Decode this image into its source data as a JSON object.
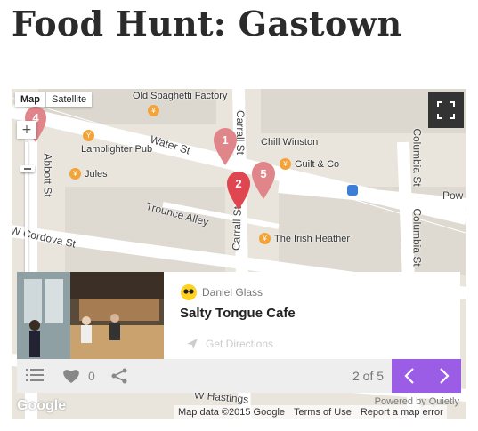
{
  "page": {
    "title": "Food Hunt: Gastown"
  },
  "map": {
    "type_options": [
      "Map",
      "Satellite"
    ],
    "streets": {
      "water_st": "Water St",
      "carrall_st_top": "Carrall St",
      "carrall_st_bottom": "Carrall St",
      "abbott_st": "Abbott St",
      "trounce_alley": "Trounce Alley",
      "w_cordova_st": "W Cordova St",
      "columbia_st_top": "Columbia St",
      "columbia_st_mid": "Columbia St",
      "powell": "Pow",
      "w_hastings": "W Hastings"
    },
    "places": {
      "old_spaghetti": "Old Spaghetti Factory",
      "lamplighter": "Lamplighter Pub",
      "jules": "Jules",
      "chill_winston": "Chill Winston",
      "guilt_co": "Guilt & Co",
      "irish_heather": "The Irish Heather"
    },
    "markers": [
      "1",
      "2",
      "4",
      "5"
    ],
    "attribution": {
      "data": "Map data ©2015 Google",
      "terms": "Terms of Use",
      "report": "Report a map error",
      "google_logo": "Google"
    }
  },
  "card": {
    "author": "Daniel Glass",
    "title": "Salty Tongue Cafe",
    "directions": "Get Directions"
  },
  "bar": {
    "likes": "0",
    "pager": "2 of 5",
    "powered_by": "Powered by Quietly"
  },
  "colors": {
    "accent": "#9b5de5",
    "marker": "#e05a61"
  }
}
